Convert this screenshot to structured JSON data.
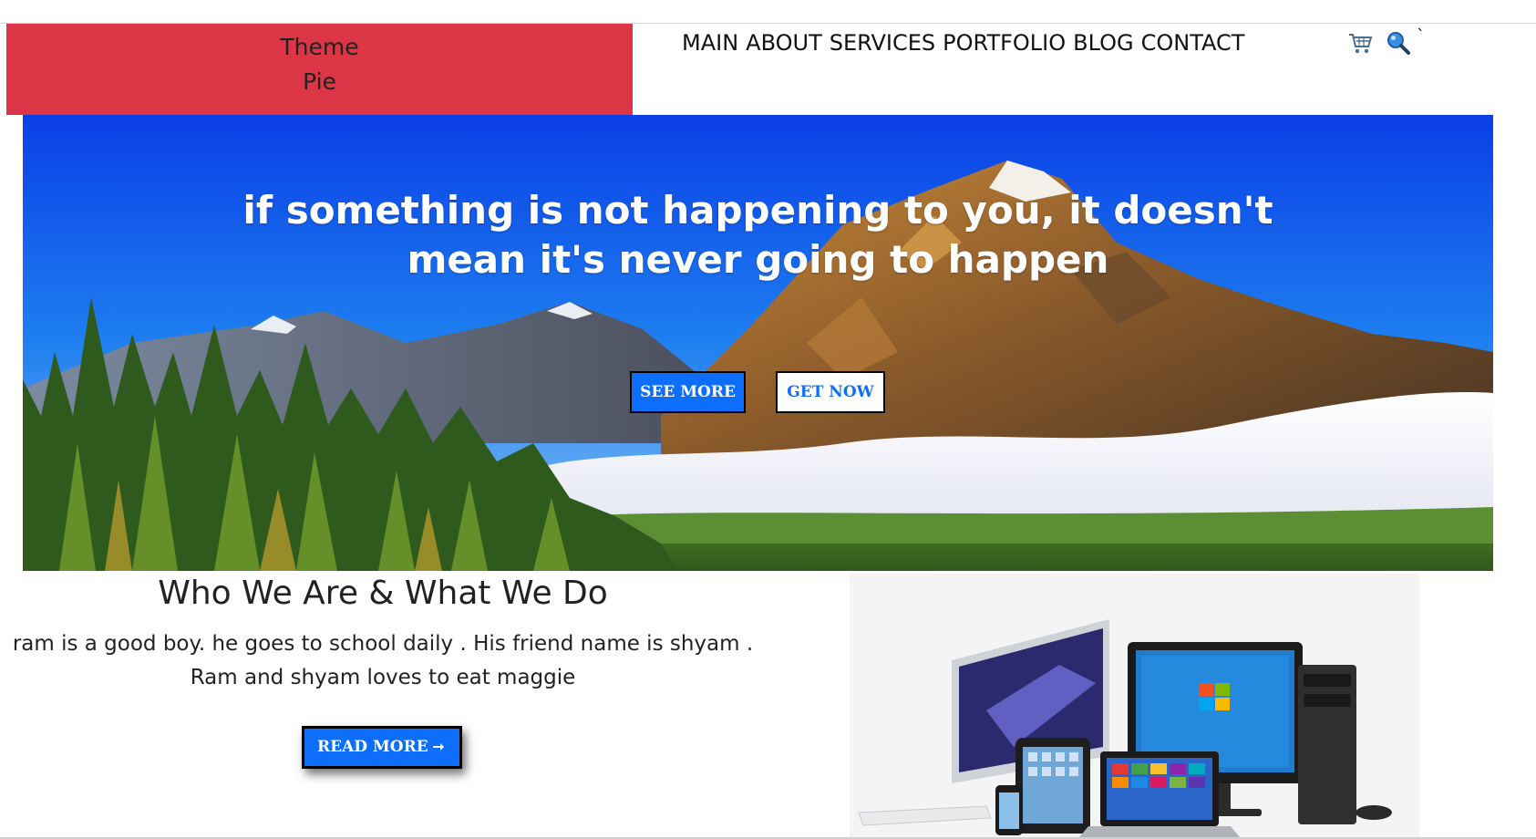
{
  "brand": {
    "line1": "Theme",
    "line2": "Pie"
  },
  "nav": {
    "items": [
      "MAIN",
      "ABOUT",
      "SERVICES",
      "PORTFOLIO",
      "BLOG",
      "CONTACT"
    ]
  },
  "header_icons": {
    "cart": "shopping-cart-icon",
    "search": "search-icon",
    "extra_char": "`"
  },
  "hero": {
    "quote_line1": "if something is not happening to you, it doesn't",
    "quote_line2": "mean it's never going to happen",
    "see_more_label": "SEE MORE",
    "get_now_label": "GET NOW",
    "image": "mountain-forest-landscape"
  },
  "about": {
    "title": "Who We Are & What We Do",
    "text_line1": "ram is a good boy. he goes to school daily . His friend name is shyam .",
    "text_line2": "Ram and shyam loves to eat maggie",
    "read_more_label": "READ MORE",
    "image": "computer-devices"
  },
  "colors": {
    "brand_red": "#dc3545",
    "primary_blue": "#0d6efd",
    "text_dark": "#222222"
  }
}
